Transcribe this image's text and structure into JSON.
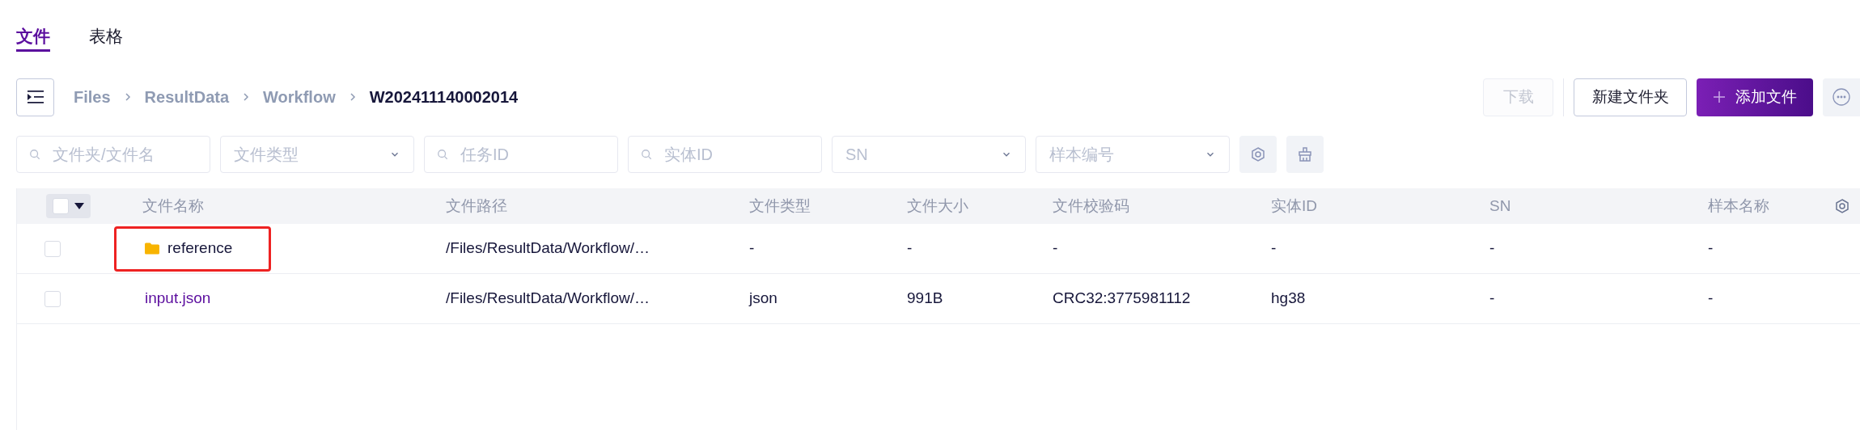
{
  "tabs": [
    {
      "label": "文件",
      "selected": true
    },
    {
      "label": "表格",
      "selected": false
    }
  ],
  "breadcrumb": [
    "Files",
    "ResultData",
    "Workflow",
    "W202411140002014"
  ],
  "actions": [
    {
      "label": "下载",
      "kind": "secondary",
      "disabled": true
    },
    {
      "label": "新建文件夹",
      "kind": "secondary"
    },
    {
      "label": "添加文件",
      "kind": "primary"
    },
    {
      "kind": "more"
    }
  ],
  "filters": [
    {
      "kind": "search",
      "placeholder": "文件夹/文件名"
    },
    {
      "kind": "select",
      "placeholder": "文件类型"
    },
    {
      "kind": "search",
      "placeholder": "任务ID"
    },
    {
      "kind": "search",
      "placeholder": "实体ID"
    },
    {
      "kind": "select",
      "placeholder": "SN"
    },
    {
      "kind": "select",
      "placeholder": "样本编号"
    }
  ],
  "table": {
    "select_all": {
      "checked": false
    },
    "columns": [
      "文件名称",
      "文件路径",
      "文件类型",
      "文件大小",
      "文件校验码",
      "实体ID",
      "SN",
      "样本名称"
    ],
    "rows": [
      {
        "kind": "folder",
        "checked": false,
        "highlighted": true,
        "cells": [
          "reference",
          "/Files/ResultData/Workflow/…",
          "-",
          "-",
          "-",
          "-",
          "-",
          "-"
        ]
      },
      {
        "kind": "file",
        "checked": false,
        "highlighted": false,
        "cells": [
          "input.json",
          "/Files/ResultData/Workflow/…",
          "json",
          "991B",
          "CRC32:3775981112",
          "hg38",
          "-",
          "-"
        ]
      }
    ]
  }
}
